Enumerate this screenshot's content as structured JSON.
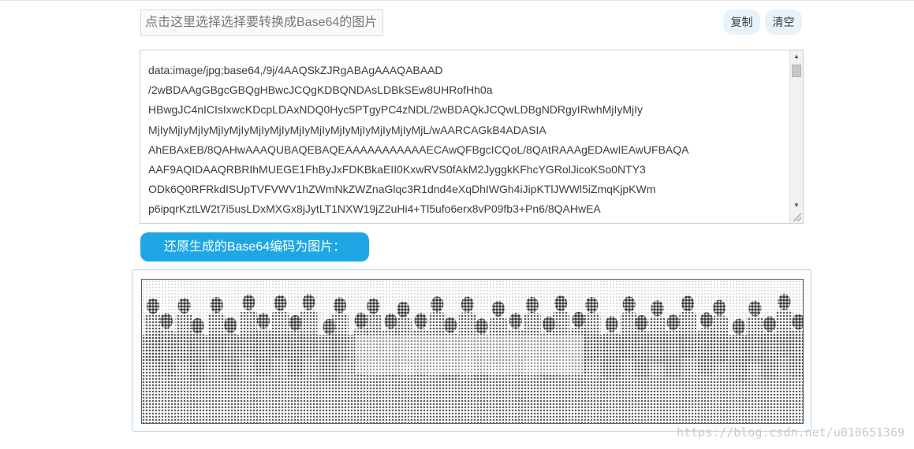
{
  "toolbar": {
    "file_chooser_label": "点击这里选择选择要转换成Base64的图片",
    "copy_label": "复制",
    "clear_label": "清空"
  },
  "base64": {
    "value": "data:image/jpg;base64,/9j/4AAQSkZJRgABAgAAAQABAAD\n/2wBDAAgGBgcGBQgHBwcJCQgKDBQNDAsLDBkSEw8UHRofHh0a\nHBwgJC4nICIsIxwcKDcpLDAxNDQ0Hyc5PTgyPC4zNDL/2wBDAQkJCQwLDBgNDRgyIRwhMjIyMjIy\nMjIyMjIyMjIyMjIyMjIyMjIyMjIyMjIyMjIyMjIyMjIyMjIyMjIyMjL/wAARCAGkB4ADASIA\nAhEBAxEB/8QAHwAAAQUBAQEBAQEAAAAAAAAAAAECAwQFBgcICQoL/8QAtRAAAgEDAwIEAwUFBAQA\nAAF9AQIDAAQRBRIhMUEGE1FhByJxFDKBkaEII0KxwRVS0fAkM2JyggkKFhcYGRolJicoKSo0NTY3\nODk6Q0RFRkdISUpTVFVWV1hZWmNkZWZnaGlqc3R1dnd4eXqDhIWGh4iJipKTlJWWl5iZmqKjpKWm\np6ipqrKztLW2t7i5usLDxMXGx8jJytLT1NXW19jZ2uHi4+Tl5ufo6erx8vP09fb3+Pn6/8QAHwEA"
  },
  "actions": {
    "restore_label": "还原生成的Base64编码为图片："
  },
  "result_image": {
    "alt": "",
    "style": "halftone grayscale group photo"
  },
  "watermark": {
    "text": "https://blog.csdn.net/u010651369"
  },
  "colors": {
    "primary": "#1ea7e4",
    "pill_bg": "#e7f2fb",
    "panel_border": "#bcd3e6"
  }
}
